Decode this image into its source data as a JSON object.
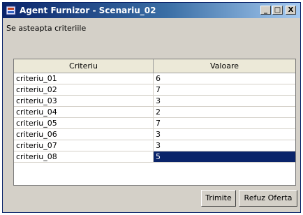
{
  "window": {
    "title": "Agent Furnizor - Scenariu_02",
    "controls": {
      "minimize": "_",
      "maximize": "□",
      "close": "X"
    }
  },
  "status_text": "Se asteapta criteriile",
  "table": {
    "columns": [
      "Criteriu",
      "Valoare"
    ],
    "rows": [
      {
        "criteriu": "criteriu_01",
        "valoare": "6"
      },
      {
        "criteriu": "criteriu_02",
        "valoare": "7"
      },
      {
        "criteriu": "criteriu_03",
        "valoare": "3"
      },
      {
        "criteriu": "criteriu_04",
        "valoare": "2"
      },
      {
        "criteriu": "criteriu_05",
        "valoare": "7"
      },
      {
        "criteriu": "criteriu_06",
        "valoare": "3"
      },
      {
        "criteriu": "criteriu_07",
        "valoare": "3"
      },
      {
        "criteriu": "criteriu_08",
        "valoare": "5"
      }
    ],
    "selected_row": 7
  },
  "buttons": {
    "send": "Trimite",
    "refuse": "Refuz Oferta"
  },
  "colors": {
    "selection": "#0a246a",
    "titlebar_start": "#0a246a",
    "titlebar_end": "#a6caf0"
  }
}
